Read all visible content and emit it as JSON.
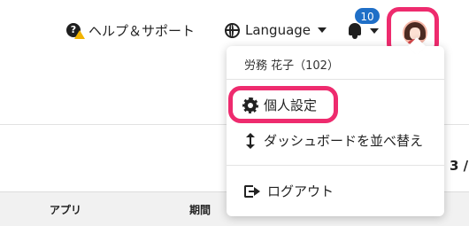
{
  "header": {
    "help_label": "ヘルプ＆サポート",
    "language_label": "Language",
    "notification_count": "10"
  },
  "user_menu": {
    "user_name": "労務 花子（102）",
    "items": [
      {
        "label": "個人設定",
        "icon": "gear-icon"
      },
      {
        "label": "ダッシュボードを並べ替え",
        "icon": "sort-icon"
      },
      {
        "label": "ログアウト",
        "icon": "logout-icon"
      }
    ]
  },
  "page": {
    "pagination_partial": "3 /",
    "table_headers": [
      "アプリ",
      "期間"
    ]
  },
  "colors": {
    "highlight": "#ee2b6e",
    "badge": "#1f6fc7"
  }
}
